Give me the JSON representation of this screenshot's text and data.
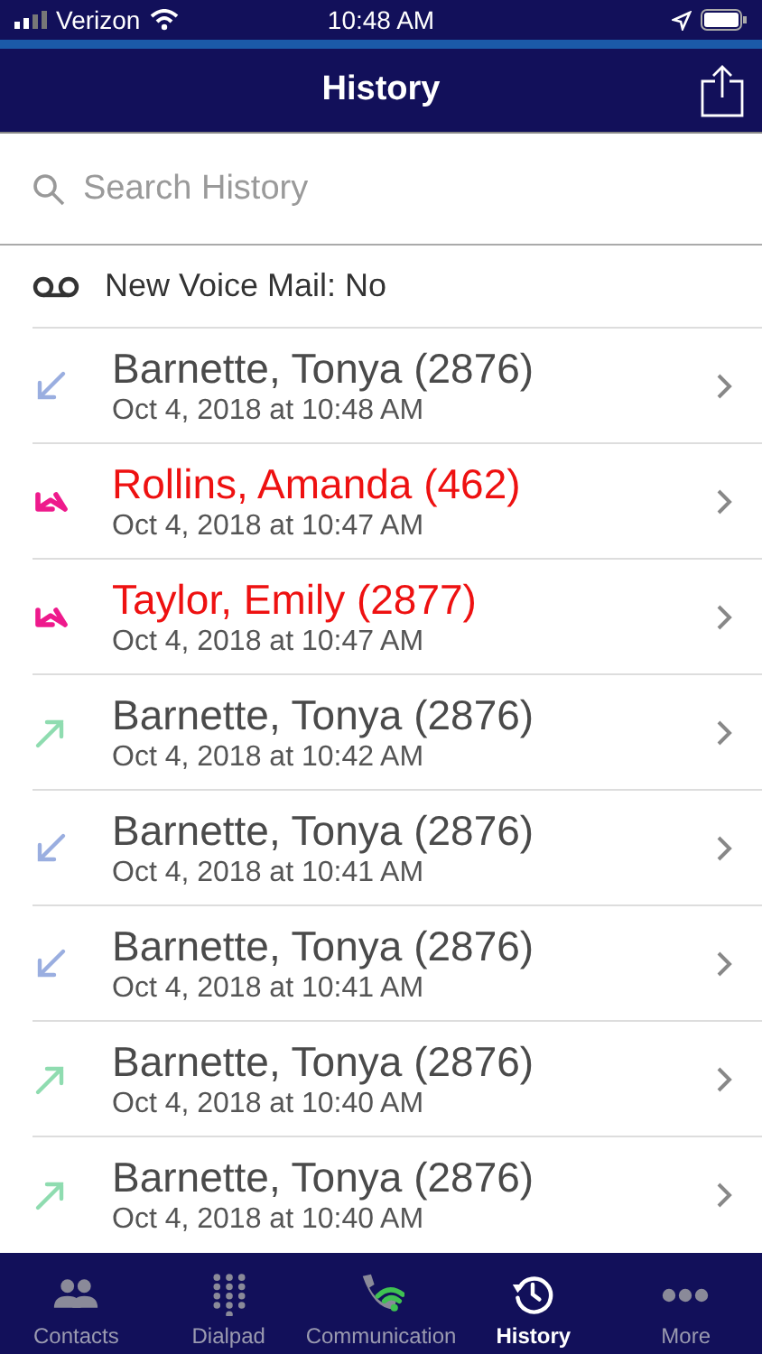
{
  "status_bar": {
    "carrier": "Verizon",
    "time": "10:48 AM"
  },
  "nav": {
    "title": "History"
  },
  "search": {
    "placeholder": "Search History"
  },
  "voicemail": {
    "label": "New Voice Mail: No"
  },
  "calls": [
    {
      "kind": "incoming",
      "name": "Barnette, Tonya (2876)",
      "time": "Oct 4, 2018 at 10:48 AM"
    },
    {
      "kind": "missed",
      "name": "Rollins, Amanda (462)",
      "time": "Oct 4, 2018 at 10:47 AM"
    },
    {
      "kind": "missed",
      "name": "Taylor, Emily (2877)",
      "time": "Oct 4, 2018 at 10:47 AM"
    },
    {
      "kind": "outgoing",
      "name": "Barnette, Tonya (2876)",
      "time": "Oct 4, 2018 at 10:42 AM"
    },
    {
      "kind": "incoming",
      "name": "Barnette, Tonya (2876)",
      "time": "Oct 4, 2018 at 10:41 AM"
    },
    {
      "kind": "incoming",
      "name": "Barnette, Tonya (2876)",
      "time": "Oct 4, 2018 at 10:41 AM"
    },
    {
      "kind": "outgoing",
      "name": "Barnette, Tonya (2876)",
      "time": "Oct 4, 2018 at 10:40 AM"
    },
    {
      "kind": "outgoing",
      "name": "Barnette, Tonya (2876)",
      "time": "Oct 4, 2018 at 10:40 AM"
    }
  ],
  "tabs": [
    {
      "kind": "contacts",
      "label": "Contacts",
      "selected": false
    },
    {
      "kind": "dialpad",
      "label": "Dialpad",
      "selected": false
    },
    {
      "kind": "communication",
      "label": "Communication",
      "selected": false
    },
    {
      "kind": "history",
      "label": "History",
      "selected": true
    },
    {
      "kind": "more",
      "label": "More",
      "selected": false
    }
  ]
}
